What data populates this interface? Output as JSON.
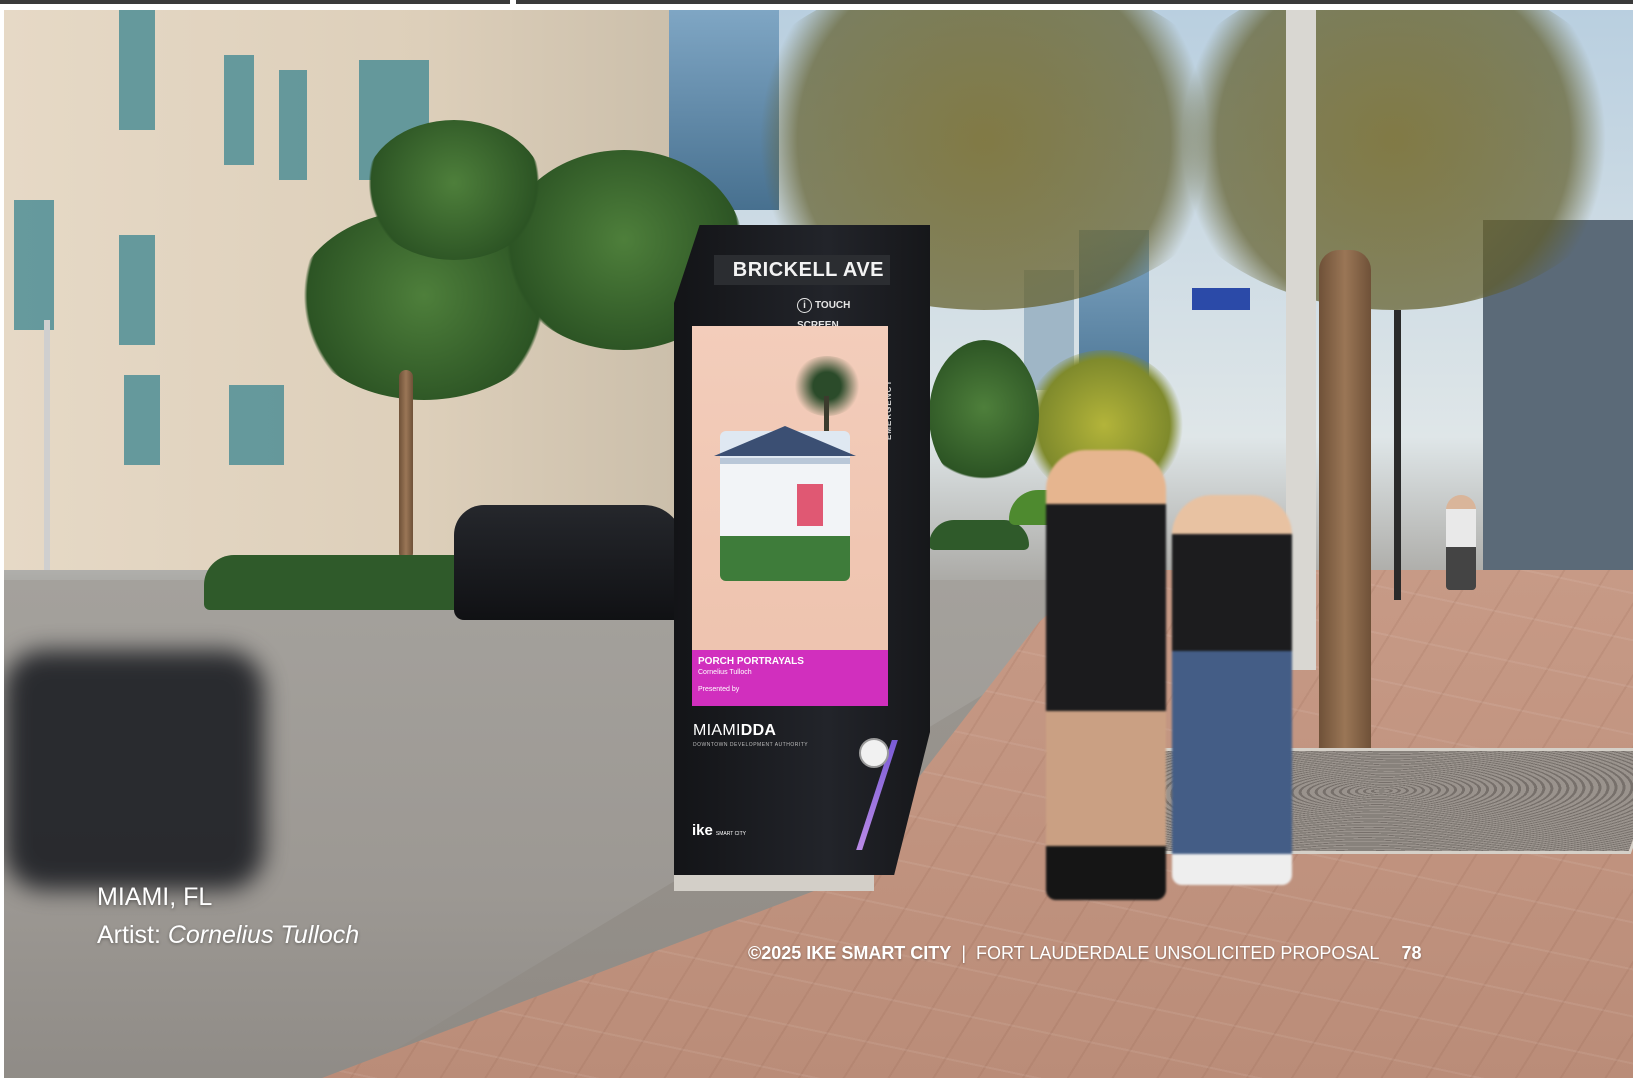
{
  "kiosk": {
    "street_name": "BRICKELL AVE",
    "touch_label": "TOUCH SCREEN",
    "side_label": "EMERGENCY",
    "screen": {
      "title": "PORCH PORTRAYALS",
      "artist": "Cornelius Tulloch",
      "presented_by": "Presented by"
    },
    "brand_logo": "MIAMI",
    "brand_logo_bold": "DDA",
    "brand_subtitle": "DOWNTOWN DEVELOPMENT AUTHORITY",
    "maker_logo": "ike",
    "maker_sub": "SMART CITY"
  },
  "caption": {
    "location": "MIAMI, FL",
    "artist_prefix": "Artist: ",
    "artist_name": "Cornelius Tulloch"
  },
  "footer": {
    "copyright": "©2025 IKE SMART CITY",
    "separator": "|",
    "document": "FORT LAUDERDALE UNSOLICITED PROPOSAL",
    "page_number": "78"
  },
  "colors": {
    "screen_banner": "#d12fbe",
    "kiosk_body": "#1a1b1f",
    "caption_text": "#ffffff"
  }
}
